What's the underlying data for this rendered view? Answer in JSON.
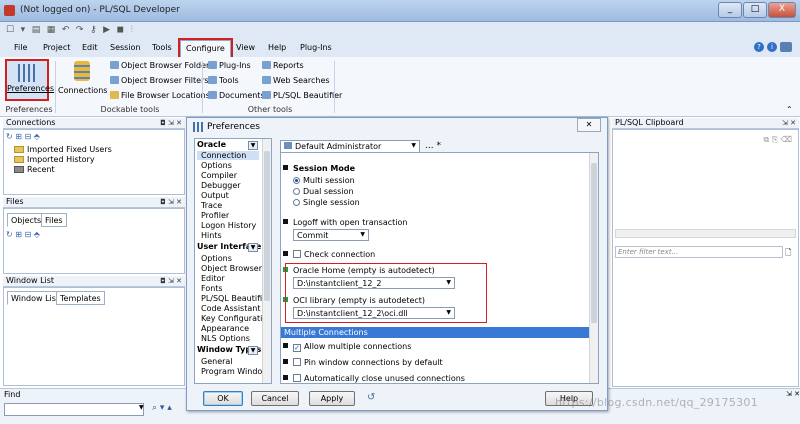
{
  "window": {
    "title": "(Not logged on) - PL/SQL Developer",
    "minimize": "_",
    "maximize": "□",
    "close": "X"
  },
  "menu": {
    "items": [
      "File",
      "Project",
      "Edit",
      "Session",
      "Tools",
      "Configure",
      "View",
      "Help",
      "Plug-Ins"
    ],
    "active": "Configure"
  },
  "ribbon": {
    "preferences": "Preferences",
    "connections": "Connections",
    "group_preferences": "Preferences",
    "obf": "Object Browser Folders",
    "obfilters": "Object Browser Filters",
    "fbl": "File Browser Locations",
    "group_dockable": "Dockable tools",
    "plugins": "Plug-Ins",
    "tools": "Tools",
    "documents": "Documents",
    "reports": "Reports",
    "websearches": "Web Searches",
    "beautifier": "PL/SQL Beautifier",
    "group_other": "Other tools"
  },
  "connections_panel": {
    "title": "Connections",
    "items": [
      "Imported Fixed Users",
      "Imported History",
      "Recent"
    ]
  },
  "files_panel": {
    "title": "Files",
    "tabs": [
      "Objects",
      "Files"
    ]
  },
  "windowlist_panel": {
    "title": "Window List",
    "tabs": [
      "Window List",
      "Templates"
    ]
  },
  "find_panel": {
    "title": "Find"
  },
  "clipboard_panel": {
    "title": "PL/SQL Clipboard",
    "filter_placeholder": "Enter filter text..."
  },
  "dialog": {
    "title": "Preferences",
    "profile": "Default Administrator",
    "categories": {
      "oracle": {
        "head": "Oracle",
        "items": [
          "Connection",
          "Options",
          "Compiler",
          "Debugger",
          "Output",
          "Trace",
          "Profiler",
          "Logon History",
          "Hints"
        ]
      },
      "ui": {
        "head": "User Interface",
        "items": [
          "Options",
          "Object Browser",
          "Editor",
          "Fonts",
          "PL/SQL Beautifier",
          "Code Assistant",
          "Key Configuration",
          "Appearance",
          "NLS Options"
        ]
      },
      "wt": {
        "head": "Window Types",
        "items": [
          "General",
          "Program Window"
        ]
      }
    },
    "session_mode": {
      "label": "Session Mode",
      "options": [
        "Multi session",
        "Dual session",
        "Single session"
      ],
      "selected": "Multi session"
    },
    "logoff": {
      "label": "Logoff with open transaction",
      "value": "Commit"
    },
    "check_connection": "Check connection",
    "oracle_home": {
      "label": "Oracle Home (empty is autodetect)",
      "value": "D:\\instantclient_12_2"
    },
    "oci_library": {
      "label": "OCI library (empty is autodetect)",
      "value": "D:\\instantclient_12_2\\oci.dll"
    },
    "multiple_connections": {
      "header": "Multiple Connections",
      "allow": "Allow multiple connections",
      "pin": "Pin window connections by default",
      "auto_close": "Automatically close unused connections"
    },
    "buttons": {
      "ok": "OK",
      "cancel": "Cancel",
      "apply": "Apply",
      "help": "Help"
    }
  },
  "watermark": "https://blog.csdn.net/qq_29175301"
}
